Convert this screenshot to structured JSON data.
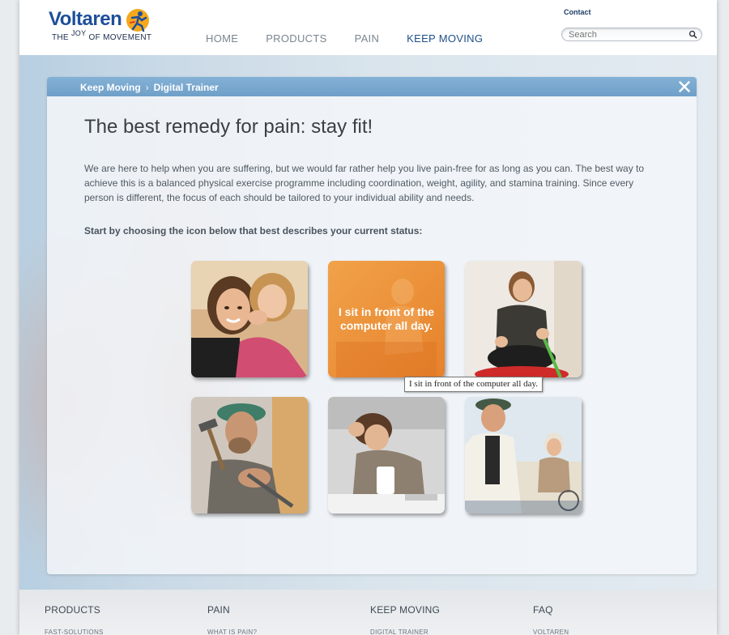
{
  "header": {
    "logo_word": "Voltaren",
    "logo_tag_pre": "THE",
    "logo_tag_joy": "JOY",
    "logo_tag_post": "OF MOVEMENT",
    "contact": "Contact",
    "search": {
      "placeholder": "Search"
    },
    "nav": [
      {
        "label": "HOME",
        "active": false
      },
      {
        "label": "PRODUCTS",
        "active": false
      },
      {
        "label": "PAIN",
        "active": false
      },
      {
        "label": "KEEP MOVING",
        "active": true
      }
    ]
  },
  "panel": {
    "breadcrumb": [
      "Keep Moving",
      "Digital Trainer"
    ],
    "title": "The best remedy for pain: stay fit!",
    "intro": "We are here to help when you are suffering, but we would far rather help you live pain-free for as long as you can. The best way to achieve this is a balanced physical exercise programme including coordination, weight, agility, and stamina training. Since every person is different, the focus of each should be tailored to your individual ability and needs.",
    "prompt": "Start by choosing the icon below that best describes your current status:",
    "tiles": [
      {
        "kind": "photo",
        "subject": "mother-and-daughter"
      },
      {
        "kind": "text",
        "label": "I sit in front of the computer all day."
      },
      {
        "kind": "photo",
        "subject": "woman-with-exercise-band"
      },
      {
        "kind": "photo",
        "subject": "craftsman-with-hammer"
      },
      {
        "kind": "photo",
        "subject": "tired-office-worker"
      },
      {
        "kind": "photo",
        "subject": "senior-couple-cycling"
      }
    ],
    "tooltip": "I sit in front of the computer all day."
  },
  "footer": {
    "columns": [
      {
        "heading": "PRODUCTS",
        "link": "FAST-SOLUTIONS"
      },
      {
        "heading": "PAIN",
        "link": "WHAT IS PAIN?"
      },
      {
        "heading": "KEEP MOVING",
        "link": "DIGITAL TRAINER"
      },
      {
        "heading": "FAQ",
        "link": "VOLTAREN"
      }
    ]
  },
  "colors": {
    "brand_blue": "#1d4f9b",
    "nav_active": "#1e4f86",
    "panel_bar": "#7aa9d0",
    "orange_tile": "#ea8a32"
  }
}
